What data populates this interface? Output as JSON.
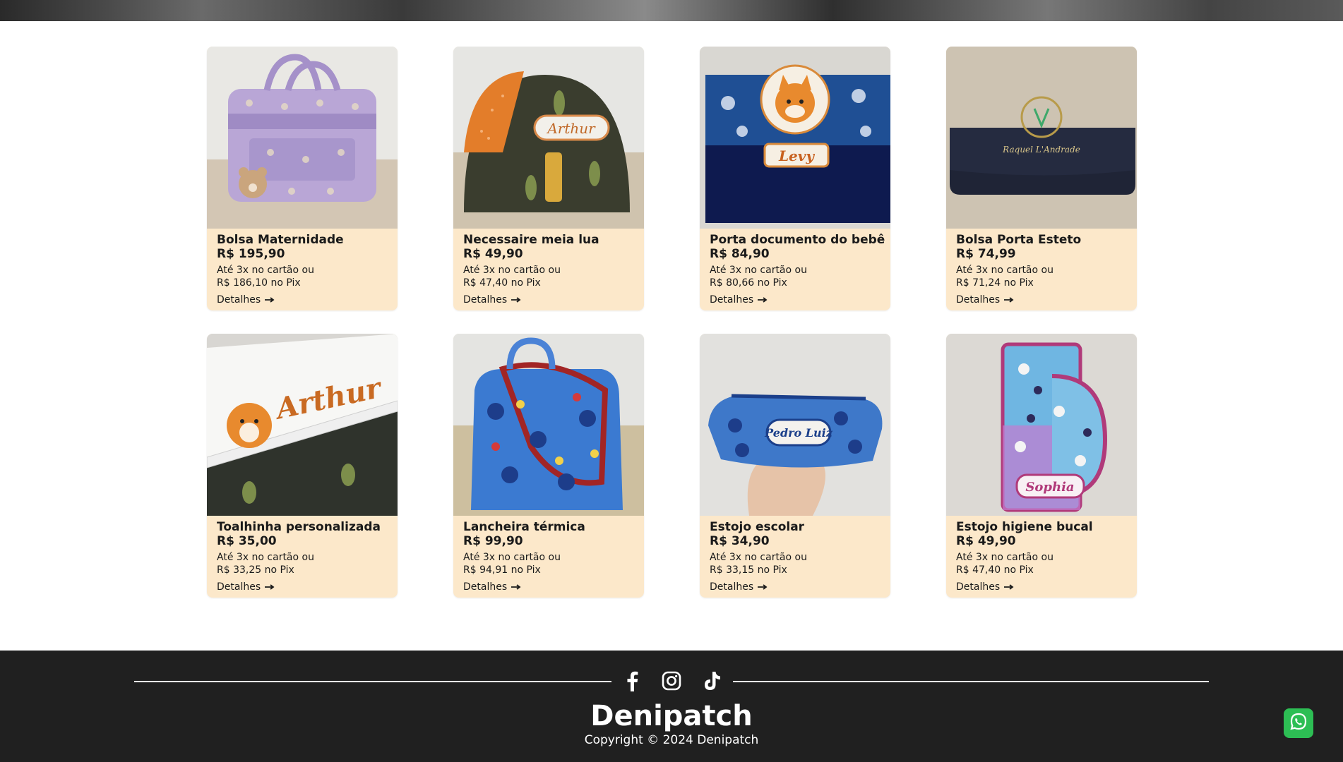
{
  "products": [
    {
      "name": "Bolsa Maternidade",
      "price": "R$ 195,90",
      "installments": "Até 3x no cartão ou",
      "pix": "R$ 186,10 no Pix",
      "details": "Detalhes"
    },
    {
      "name": "Necessaire meia lua",
      "price": "R$ 49,90",
      "installments": "Até 3x no cartão ou",
      "pix": "R$ 47,40 no Pix",
      "details": "Detalhes",
      "embroidery": "Arthur"
    },
    {
      "name": "Porta documento do bebê",
      "price": "R$ 84,90",
      "installments": "Até 3x no cartão ou",
      "pix": "R$ 80,66 no Pix",
      "details": "Detalhes",
      "embroidery": "Levy"
    },
    {
      "name": "Bolsa Porta Esteto",
      "price": "R$ 74,99",
      "installments": "Até 3x no cartão ou",
      "pix": "R$ 71,24 no Pix",
      "details": "Detalhes",
      "embroidery": "Raquel L'Andrade"
    },
    {
      "name": "Toalhinha personalizada",
      "price": "R$ 35,00",
      "installments": "Até 3x no cartão ou",
      "pix": "R$ 33,25 no Pix",
      "details": "Detalhes",
      "embroidery": "Arthur"
    },
    {
      "name": "Lancheira térmica",
      "price": "R$ 99,90",
      "installments": "Até 3x no cartão ou",
      "pix": "R$ 94,91 no Pix",
      "details": "Detalhes"
    },
    {
      "name": "Estojo escolar",
      "price": "R$ 34,90",
      "installments": "Até 3x no cartão ou",
      "pix": "R$ 33,15 no Pix",
      "details": "Detalhes",
      "embroidery": "Pedro Luiz"
    },
    {
      "name": "Estojo higiene bucal",
      "price": "R$ 49,90",
      "installments": "Até 3x no cartão ou",
      "pix": "R$ 47,40 no Pix",
      "details": "Detalhes",
      "embroidery": "Sophia"
    }
  ],
  "footer": {
    "social": [
      "facebook-icon",
      "instagram-icon",
      "tiktok-icon"
    ],
    "brand": "Denipatch",
    "copyright": "Copyright © 2024 Denipatch"
  },
  "colors": {
    "card_background": "#fce8ca",
    "footer_background": "#202020",
    "whatsapp": "#2dbe54"
  }
}
